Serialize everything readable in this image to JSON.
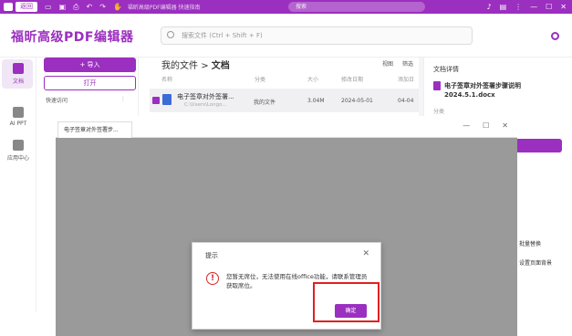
{
  "titlebar": {
    "tab_label": "返回",
    "hint": "福昕高级PDF编辑器 快速指南",
    "search_placeholder": "搜索"
  },
  "header": {
    "app_name": "福昕高级PDF编辑器",
    "search_placeholder": "搜索文件 (Ctrl + Shift + F)"
  },
  "nav": {
    "items": [
      {
        "label": "文档"
      },
      {
        "label": "AI PPT"
      },
      {
        "label": "应用中心"
      }
    ]
  },
  "side": {
    "import_label": "+ 导入",
    "open_label": "打开",
    "recent_label": "快速访问"
  },
  "main": {
    "crumb_root": "我的文件",
    "crumb_sep": ">",
    "crumb_current": "文档",
    "tool_view": "视图",
    "tool_filter": "筛选",
    "columns": [
      "名称",
      "分类",
      "大小",
      "修改日期",
      "添加日"
    ],
    "row": {
      "name": "电子签章对外签署...",
      "path": "C:\\Users\\Longo...",
      "category": "我的文件",
      "size": "3.04M",
      "date": "2024-05-01",
      "added": "04-04"
    }
  },
  "details": {
    "title": "文档详情",
    "file_name": "电子签章对外签署步骤说明2024.5.1.docx",
    "category_label": "分类",
    "link1": "批量替换",
    "link2": "设置页面背景"
  },
  "overlay": {
    "tab_title": "电子签章对外签署步..."
  },
  "dialog": {
    "title": "提示",
    "message": "您暂无席位，无法使用在线office功能，请联系管理员获取席位。",
    "ok_label": "确定"
  }
}
